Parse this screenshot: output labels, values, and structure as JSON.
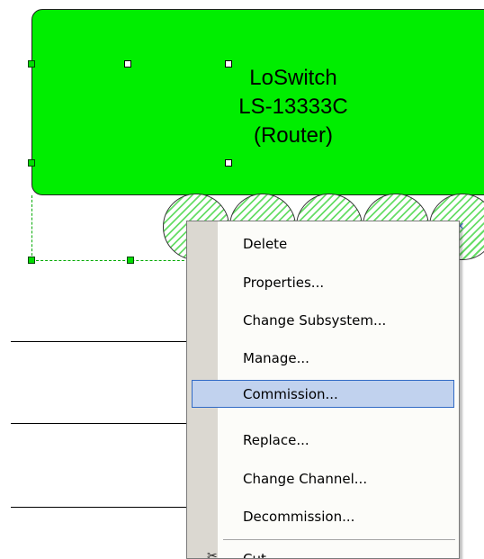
{
  "device": {
    "line1": "LoSwitch",
    "line2": "LS-13333C",
    "line3": "(Router)",
    "fill_color": "#00ee00"
  },
  "context_menu": {
    "items": [
      {
        "label": "Delete"
      },
      {
        "label": "Properties..."
      },
      {
        "label": "Change Subsystem..."
      },
      {
        "label": "Manage..."
      },
      {
        "label": "Commission...",
        "highlighted": true
      },
      {
        "label": "Replace..."
      },
      {
        "label": "Change Channel..."
      },
      {
        "label": "Decommission..."
      },
      {
        "label": "Cut",
        "icon": "scissors-icon"
      }
    ],
    "highlight_color": "#c1d2ee",
    "highlight_border": "#316ac5"
  }
}
